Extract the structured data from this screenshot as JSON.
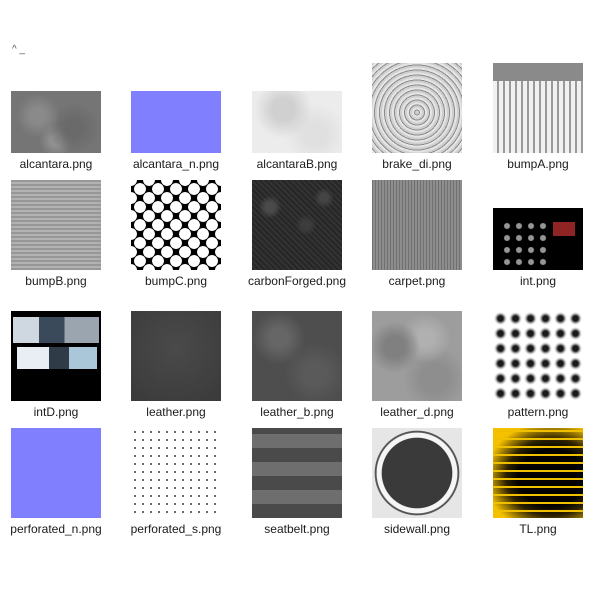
{
  "window": {
    "stray_text": "^ _"
  },
  "files": [
    {
      "name": "alcantara.png",
      "texture": "gray-noise"
    },
    {
      "name": "alcantara_n.png",
      "texture": "normal-map-blue"
    },
    {
      "name": "alcantaraB.png",
      "texture": "light-gray-noise"
    },
    {
      "name": "brake_di.png",
      "texture": "concentric-rings"
    },
    {
      "name": "bumpA.png",
      "texture": "vertical-stripes"
    },
    {
      "name": "bumpB.png",
      "texture": "fine-grid"
    },
    {
      "name": "bumpC.png",
      "texture": "white-hexagon-holes"
    },
    {
      "name": "carbonForged.png",
      "texture": "dark-speckle"
    },
    {
      "name": "carpet.png",
      "texture": "gray-fibers"
    },
    {
      "name": "int.png",
      "texture": "icon-sheet-black"
    },
    {
      "name": "intD.png",
      "texture": "ui-screenshots"
    },
    {
      "name": "leather.png",
      "texture": "dark-gray"
    },
    {
      "name": "leather_b.png",
      "texture": "gray-mottled"
    },
    {
      "name": "leather_d.png",
      "texture": "light-mottled"
    },
    {
      "name": "pattern.png",
      "texture": "gradient-holes"
    },
    {
      "name": "perforated_n.png",
      "texture": "normal-map-blue"
    },
    {
      "name": "perforated_s.png",
      "texture": "white-dot-grid"
    },
    {
      "name": "seatbelt.png",
      "texture": "horizontal-bands"
    },
    {
      "name": "sidewall.png",
      "texture": "tire-sidewall"
    },
    {
      "name": "TL.png",
      "texture": "yellow-taillight"
    }
  ],
  "colors": {
    "label": "#1a1a1a",
    "background": "#ffffff",
    "normal_map": "#8080ff"
  }
}
